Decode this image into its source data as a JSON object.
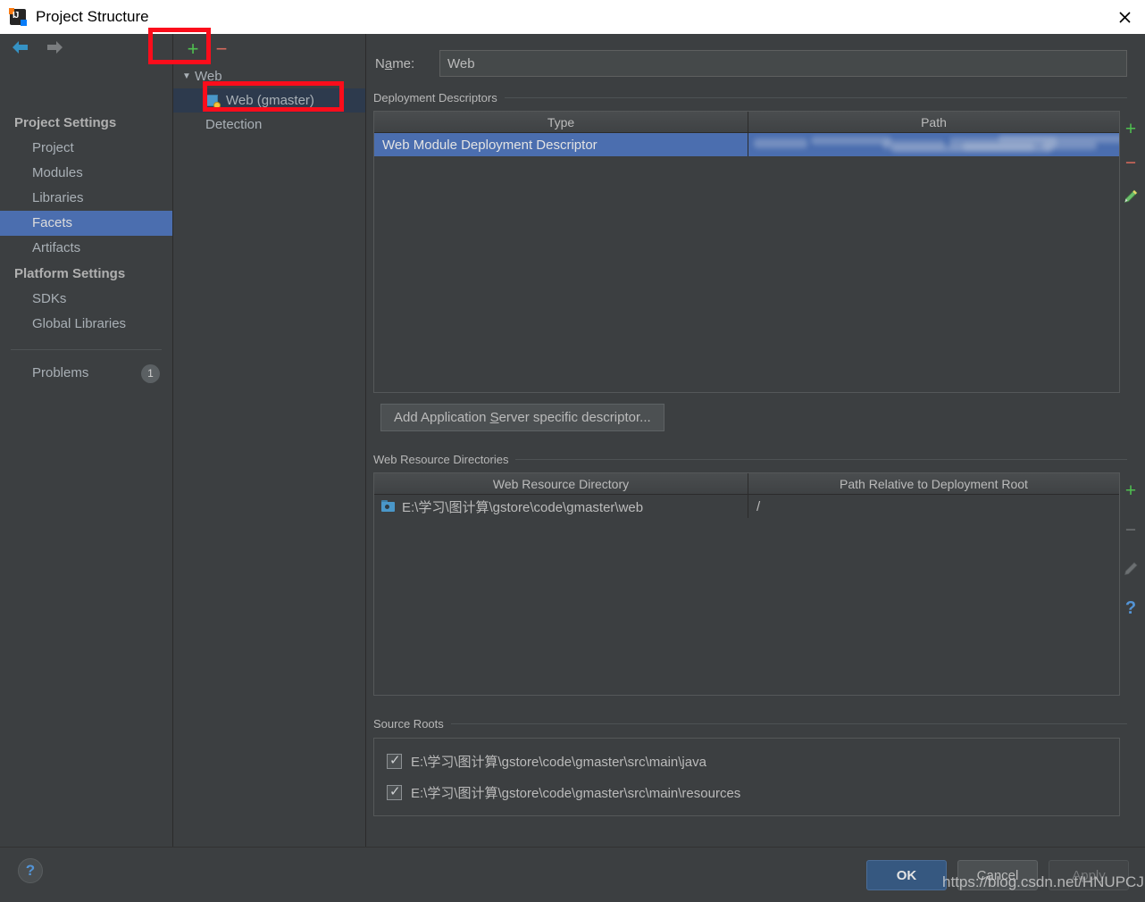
{
  "window": {
    "title": "Project Structure",
    "logo_text": "IJ",
    "close_icon": "close-icon"
  },
  "nav": {
    "back_icon": "arrow-back-icon",
    "forward_icon": "arrow-forward-icon"
  },
  "sidebar": {
    "groups": [
      {
        "label": "Project Settings",
        "items": [
          {
            "label": "Project",
            "selected": false
          },
          {
            "label": "Modules",
            "selected": false
          },
          {
            "label": "Libraries",
            "selected": false
          },
          {
            "label": "Facets",
            "selected": true
          },
          {
            "label": "Artifacts",
            "selected": false
          }
        ]
      },
      {
        "label": "Platform Settings",
        "items": [
          {
            "label": "SDKs",
            "selected": false
          },
          {
            "label": "Global Libraries",
            "selected": false
          }
        ]
      }
    ],
    "problems": {
      "label": "Problems",
      "count": "1"
    }
  },
  "tree": {
    "toolbar": {
      "add_icon": "plus-icon",
      "remove_icon": "minus-icon"
    },
    "root": {
      "label": "Web",
      "expander": "▼"
    },
    "child": {
      "label": "Web (gmaster)",
      "icon": "web-facet-icon",
      "selected": true
    },
    "detection": {
      "label": "Detection"
    }
  },
  "main": {
    "name_field": {
      "label_pre": "N",
      "label_mnemonic": "a",
      "label_post": "me:",
      "value": "Web",
      "placeholder": "Name"
    },
    "deployment_descriptors": {
      "title": "Deployment Descriptors",
      "columns": [
        "Type",
        "Path"
      ],
      "rows": [
        {
          "type": "Web Module Deployment Descriptor",
          "path": "",
          "path_redacted": true,
          "selected": true
        }
      ],
      "add_descriptor_button": {
        "pre": "Add Application ",
        "mnemonic": "S",
        "post": "erver specific descriptor..."
      },
      "tools": [
        "plus-icon",
        "minus-icon",
        "edit-pencil-icon"
      ]
    },
    "web_resource_directories": {
      "title": "Web Resource Directories",
      "columns": [
        "Web Resource Directory",
        "Path Relative to Deployment Root"
      ],
      "rows": [
        {
          "directory": "E:\\学习\\图计算\\gstore\\code\\gmaster\\web",
          "relative_path": "/"
        }
      ],
      "tools": [
        "plus-icon",
        "minus-icon-disabled",
        "edit-pencil-icon-disabled",
        "help-icon"
      ]
    },
    "source_roots": {
      "title": "Source Roots",
      "rows": [
        {
          "path": "E:\\学习\\图计算\\gstore\\code\\gmaster\\src\\main\\java",
          "checked": true
        },
        {
          "path": "E:\\学习\\图计算\\gstore\\code\\gmaster\\src\\main\\resources",
          "checked": true
        }
      ]
    }
  },
  "footer": {
    "help_icon": "question-mark-icon",
    "ok": "OK",
    "cancel": "Cancel",
    "apply": "Apply"
  },
  "watermark": "https://blog.csdn.net/HNUPCJ",
  "colors": {
    "selection_blue": "#4b6eaf",
    "tree_selection": "#2d3a4d",
    "panel_bg": "#3c3f41",
    "accent_green": "#4fc04f",
    "accent_red": "#d96a5c",
    "annotation_red": "#fb0d1b",
    "ok_button": "#365880"
  }
}
